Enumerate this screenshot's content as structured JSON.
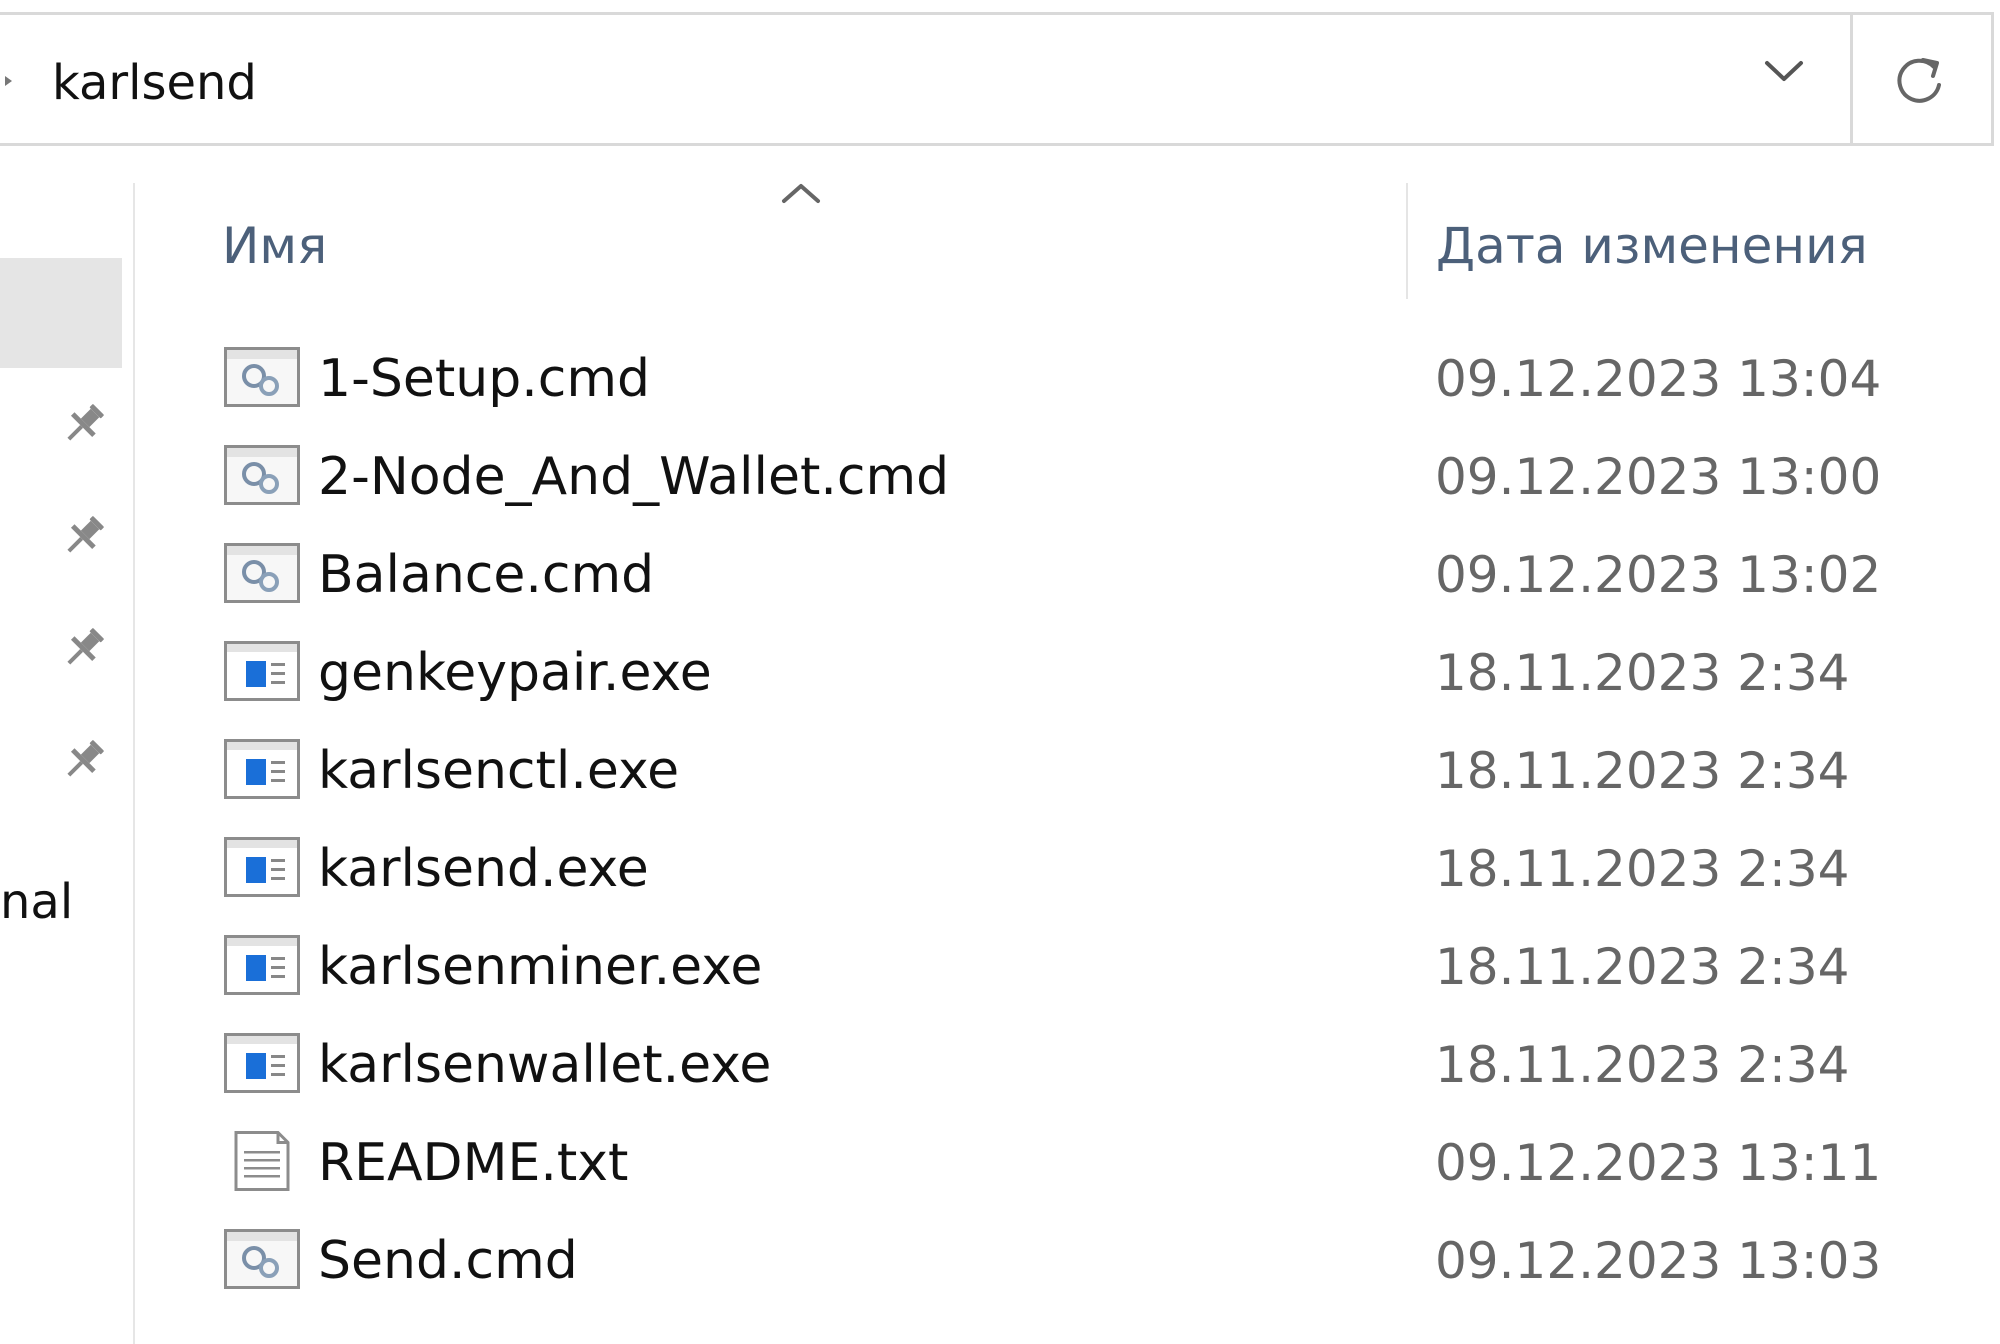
{
  "address_bar": {
    "path": "karlsend",
    "history_icon": "chevron-down-icon",
    "refresh_icon": "refresh-icon"
  },
  "navigation_pane": {
    "pin_icon": "pin-icon",
    "partial_label": "nal"
  },
  "columns": {
    "name": "Имя",
    "date_modified": "Дата изменения",
    "sort_icon": "sort-ascending-icon"
  },
  "files": [
    {
      "name": "1-Setup.cmd",
      "date": "09.12.2023 13:04",
      "icon": "cmd-file-icon"
    },
    {
      "name": "2-Node_And_Wallet.cmd",
      "date": "09.12.2023 13:00",
      "icon": "cmd-file-icon"
    },
    {
      "name": "Balance.cmd",
      "date": "09.12.2023 13:02",
      "icon": "cmd-file-icon"
    },
    {
      "name": "genkeypair.exe",
      "date": "18.11.2023 2:34",
      "icon": "exe-file-icon"
    },
    {
      "name": "karlsenctl.exe",
      "date": "18.11.2023 2:34",
      "icon": "exe-file-icon"
    },
    {
      "name": "karlsend.exe",
      "date": "18.11.2023 2:34",
      "icon": "exe-file-icon"
    },
    {
      "name": "karlsenminer.exe",
      "date": "18.11.2023 2:34",
      "icon": "exe-file-icon"
    },
    {
      "name": "karlsenwallet.exe",
      "date": "18.11.2023 2:34",
      "icon": "exe-file-icon"
    },
    {
      "name": "README.txt",
      "date": "09.12.2023 13:11",
      "icon": "text-file-icon"
    },
    {
      "name": "Send.cmd",
      "date": "09.12.2023 13:03",
      "icon": "cmd-file-icon"
    }
  ]
}
